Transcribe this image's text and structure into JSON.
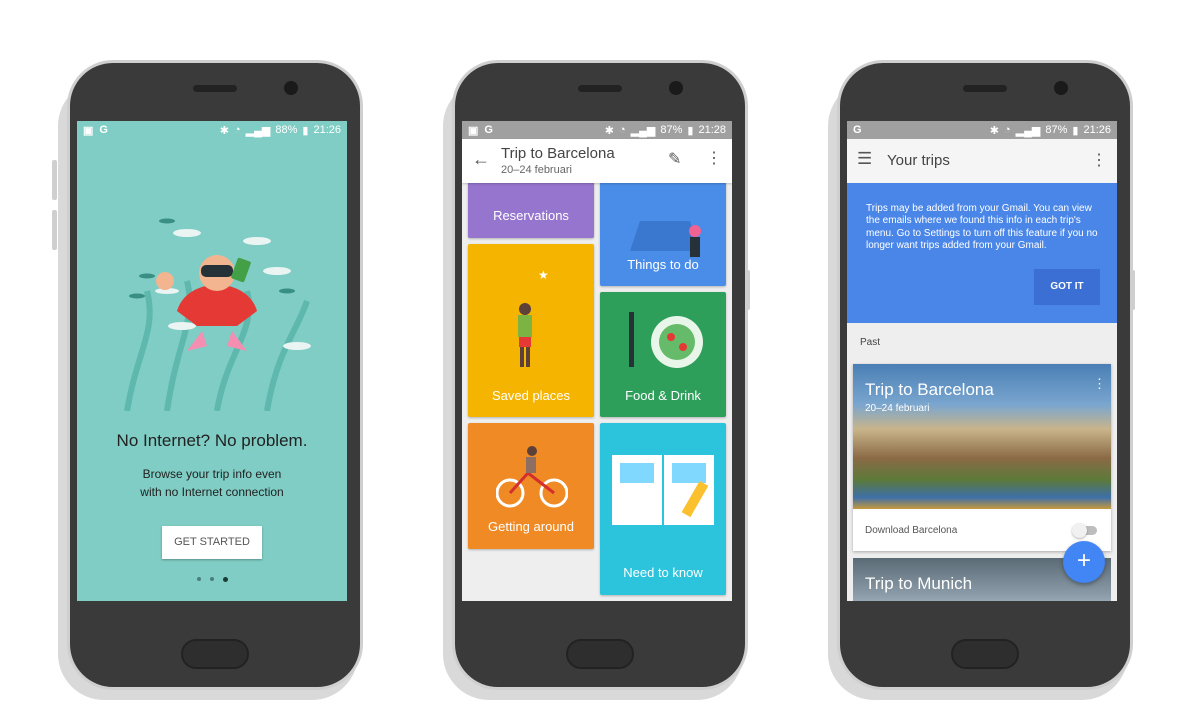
{
  "phones": [
    {
      "status": {
        "left_icons": [
          "image-icon",
          "google-icon"
        ],
        "g": "G",
        "battery": "88%",
        "time": "21:26"
      },
      "heading": "No Internet? No problem.",
      "body_line1": "Browse your trip info even",
      "body_line2": "with no Internet connection",
      "button": "GET STARTED",
      "page_dots": {
        "count": 3,
        "active": 3
      },
      "bg_color": "#7fcdc4"
    },
    {
      "status": {
        "g": "G",
        "battery": "87%",
        "time": "21:28"
      },
      "title": "Trip to Barcelona",
      "subtitle": "20–24 februari",
      "tiles": [
        {
          "label": "Reservations",
          "color": "#9575cd"
        },
        {
          "label": "Things to do",
          "color": "#4a8de8"
        },
        {
          "label": "Saved places",
          "color": "#f4b400"
        },
        {
          "label": "Food & Drink",
          "color": "#2e9e5b"
        },
        {
          "label": "Getting around",
          "color": "#ef8a24"
        },
        {
          "label": "Need to know",
          "color": "#2cc4dd"
        }
      ]
    },
    {
      "status": {
        "g": "G",
        "battery": "87%",
        "time": "21:26"
      },
      "title": "Your trips",
      "banner_text": "Trips may be added from your Gmail. You can view the emails where we found this info in each trip's menu. Go to Settings to turn off this feature if you no longer want trips added from your Gmail.",
      "banner_button": "GOT IT",
      "banner_color": "#4a86e8",
      "section": "Past",
      "trips": [
        {
          "title": "Trip to Barcelona",
          "dates": "20–24 februari",
          "download_label": "Download Barcelona",
          "download_enabled": false
        },
        {
          "title": "Trip to Munich"
        }
      ],
      "fab": "+"
    }
  ]
}
